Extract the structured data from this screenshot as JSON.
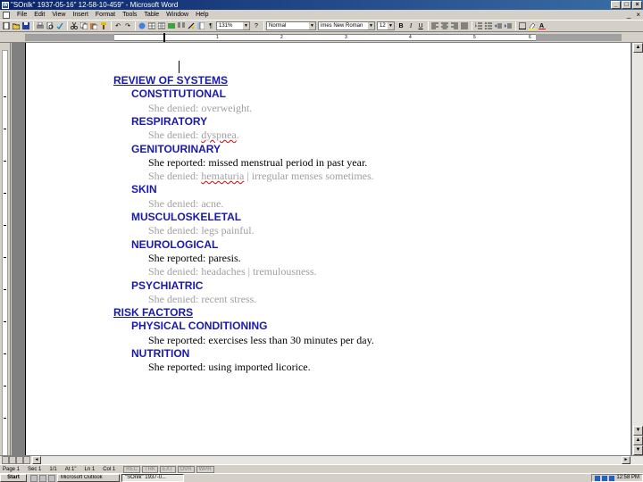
{
  "window": {
    "title": "\"SOnlk\" 1937-05-16\" 12-58-10-459\" - Microsoft Word",
    "minimize": "_",
    "maximize": "□",
    "close": "×"
  },
  "menu": {
    "items": [
      "File",
      "Edit",
      "View",
      "Insert",
      "Format",
      "Tools",
      "Table",
      "Window",
      "Help"
    ],
    "mdi_min": "_",
    "mdi_close": "×"
  },
  "toolbar": {
    "zoom": "131%",
    "style": "Normal",
    "font": "imes New Roman",
    "size": "12",
    "bold": "B",
    "italic": "I",
    "underline": "U"
  },
  "ruler": {
    "ticks": [
      "1",
      "2",
      "3",
      "4",
      "5",
      "6"
    ]
  },
  "document": {
    "lines": [
      {
        "kind": "h1",
        "text": "REVIEW OF SYSTEMS"
      },
      {
        "kind": "h2",
        "text": "CONSTITUTIONAL"
      },
      {
        "kind": "neg",
        "text": "She denied: overweight."
      },
      {
        "kind": "h2",
        "text": "RESPIRATORY"
      },
      {
        "kind": "neg",
        "text": "She denied: ",
        "spell": "dyspnea",
        "after": "."
      },
      {
        "kind": "h2",
        "text": "GENITOURINARY"
      },
      {
        "kind": "pos",
        "text": "She reported: missed menstrual period in past year."
      },
      {
        "kind": "neg",
        "text": "She denied: ",
        "spell": "hematuria",
        "after": " | irregular menses sometimes."
      },
      {
        "kind": "h2",
        "text": "SKIN"
      },
      {
        "kind": "neg",
        "text": "She denied: acne."
      },
      {
        "kind": "h2",
        "text": "MUSCULOSKELETAL"
      },
      {
        "kind": "neg",
        "text": "She denied: legs painful."
      },
      {
        "kind": "h2",
        "text": "NEUROLOGICAL"
      },
      {
        "kind": "pos",
        "text": "She reported: paresis."
      },
      {
        "kind": "neg",
        "text": "She denied: headaches | tremulousness."
      },
      {
        "kind": "h2",
        "text": "PSYCHIATRIC"
      },
      {
        "kind": "neg",
        "text": "She denied: recent stress."
      },
      {
        "kind": "h1",
        "text": "RISK FACTORS"
      },
      {
        "kind": "h2",
        "text": "PHYSICAL CONDITIONING"
      },
      {
        "kind": "pos",
        "text": "She reported: exercises less than 30 minutes per day."
      },
      {
        "kind": "h2",
        "text": "NUTRITION"
      },
      {
        "kind": "pos",
        "text": "She reported: using imported licorice."
      }
    ]
  },
  "status": {
    "page": "Page 1",
    "sec": "Sec 1",
    "pages": "1/1",
    "at": "At 1\"",
    "ln": "Ln 1",
    "col": "Col 1",
    "rec": "REC",
    "trk": "TRK",
    "ext": "EXT",
    "ovr": "OVR",
    "wph": "WPH"
  },
  "taskbar": {
    "start": "Start",
    "tasks": [
      "Microsoft Outlook",
      "\"SOnlk\" 1937-0..."
    ],
    "clock": "12:58 PM"
  }
}
